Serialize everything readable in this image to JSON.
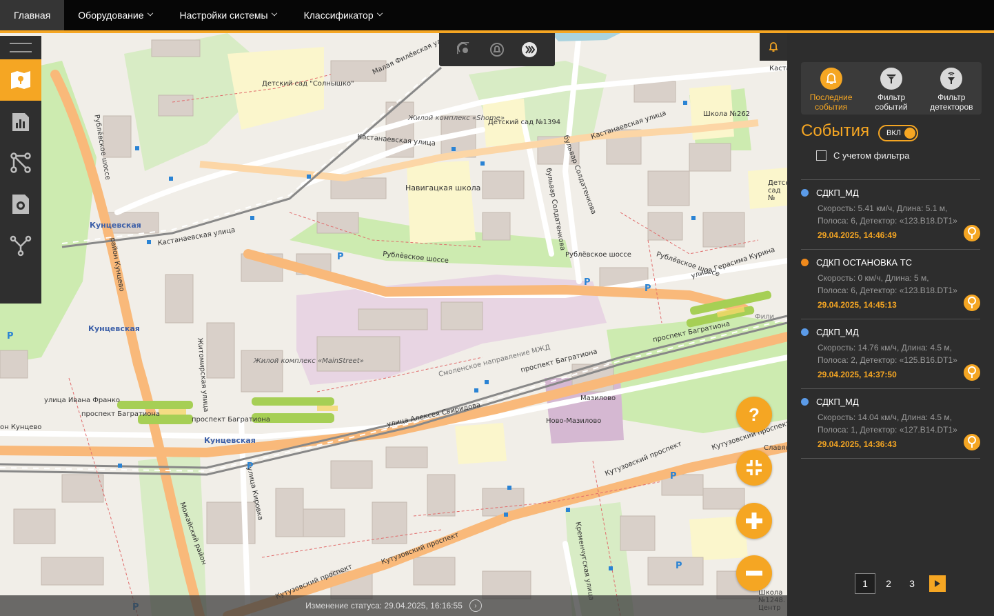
{
  "nav": {
    "items": [
      {
        "label": "Главная",
        "active": true,
        "dropdown": false
      },
      {
        "label": "Оборудование",
        "active": false,
        "dropdown": true
      },
      {
        "label": "Настройки системы",
        "active": false,
        "dropdown": true
      },
      {
        "label": "Классификатор",
        "active": false,
        "dropdown": true
      }
    ]
  },
  "colors": {
    "accent": "#f5a623",
    "nav_bg": "#060606",
    "panel_bg": "#2d2d2d",
    "event_blue": "#5b9be8",
    "event_orange": "#f08a1c"
  },
  "left_toolbar": {
    "items": [
      "menu-icon",
      "map-icon",
      "chart-icon",
      "graph-icon",
      "camera-icon",
      "network-icon"
    ]
  },
  "map_topbar": {
    "icons": [
      "radar-icon",
      "alarm-icon",
      "traffic-icon"
    ]
  },
  "map": {
    "labels": {
      "detsad1": "Детский сад \"Солнышко\"",
      "zhk_shome": "Жилой комплекс «Shome»",
      "detsad1394": "Детский сад №1394",
      "school262": "Школа №262",
      "navigator": "Навигацкая школа",
      "kuntsevskaya1": "Кунцевская",
      "kuntsevskaya2": "Кунцевская",
      "kuntsevskaya3": "Кунцевская",
      "kastanaevskaya1": "Кастанаевская улица",
      "kastanaevskaya2": "Кастанаевская улица",
      "kastanaevskaya3": "Кастанаевская улица",
      "rublevskoe1": "Рублёвское шоссе",
      "rublevskoe2": "Рублёвское шоссе",
      "rublevskoe3": "Рублёвское шоссе",
      "rublevskoe_v": "Рублёвское шоссе",
      "malaya_filevskaya": "Малая Филёвская улица",
      "gerasima": "улица Герасима Курина",
      "bagrationa1": "проспект Багратиона",
      "bagrationa2": "проспект Багратиона",
      "bagrationa3": "проспект Багратиона",
      "bagrationa4": "проспект Багратиона",
      "zhk_main": "Жилой комплекс «MainStreet»",
      "ivana_franko": "улица Ивана Франко",
      "sviridova": "улица Алексея Свиридова",
      "kutuzovsky1": "Кутузовский проспект",
      "kutuzovsky2": "Кутузовский проспект",
      "kutuzovsky3": "Кутузовский проспект",
      "kutuzovsky4": "Кутузовский проспект",
      "mazilovo": "Мазилово",
      "novo_mazilovo": "Ново-Мазилово",
      "kremenchugskaya": "Кременчугская улица",
      "kirovka": "улица Кировка",
      "zhitomirskaya": "Житомирская улица",
      "mozhayskiy": "Можайский район",
      "rayon_kuntsevo": "район Кунцево",
      "soldatenkova": "бульвар Солдатенкова",
      "soldatenkova2": "бульвар Солдатенкова",
      "smolenskoe": "Смоленское направление МЖД",
      "fili": "Фили",
      "kuntsevo_left": "он Кунцево",
      "slavyan": "Славян",
      "detsad_right": "Детск сад №",
      "kasta_right": "Каста",
      "school1248": "Школа №1248. Центр"
    }
  },
  "status_bar": {
    "text": "Изменение статуса: 29.04.2025, 16:16:55"
  },
  "panel": {
    "tabs": [
      {
        "label": "Последние события",
        "icon": "bell-icon",
        "active": true
      },
      {
        "label": "Фильтр событий",
        "icon": "filter-icon",
        "active": false
      },
      {
        "label": "Фильтр детекторов",
        "icon": "detector-filter-icon",
        "active": false
      }
    ],
    "title": "События",
    "toggle_label": "ВКЛ",
    "toggle_on": true,
    "filter_checkbox_label": "С учетом фильтра",
    "filter_checked": false,
    "events": [
      {
        "title": "СДКП_МД",
        "color": "#5b9be8",
        "line1": "Скорость: 5.41 км/ч, Длина: 5.1 м,",
        "line2": "Полоса: 6, Детектор: «123.B18.DT1»",
        "time": "29.04.2025, 14:46:49"
      },
      {
        "title": "СДКП ОСТАНОВКА ТС",
        "color": "#f08a1c",
        "line1": "Скорость: 0 км/ч, Длина: 5 м,",
        "line2": "Полоса: 6, Детектор: «123.B18.DT1»",
        "time": "29.04.2025, 14:45:13"
      },
      {
        "title": "СДКП_МД",
        "color": "#5b9be8",
        "line1": "Скорость: 14.76 км/ч, Длина: 4.5 м,",
        "line2": "Полоса: 2, Детектор: «125.B16.DT1»",
        "time": "29.04.2025, 14:37:50"
      },
      {
        "title": "СДКП_МД",
        "color": "#5b9be8",
        "line1": "Скорость: 14.04 км/ч, Длина: 4.5 м,",
        "line2": "Полоса: 1, Детектор: «127.B14.DT1»",
        "time": "29.04.2025, 14:36:43"
      }
    ],
    "pagination": {
      "pages": [
        "1",
        "2",
        "3"
      ],
      "current": "1"
    }
  },
  "map_controls": {
    "help": "?",
    "fit": "fit-screen-icon",
    "zoom_in": "plus-icon",
    "zoom_out": "minus-icon"
  }
}
